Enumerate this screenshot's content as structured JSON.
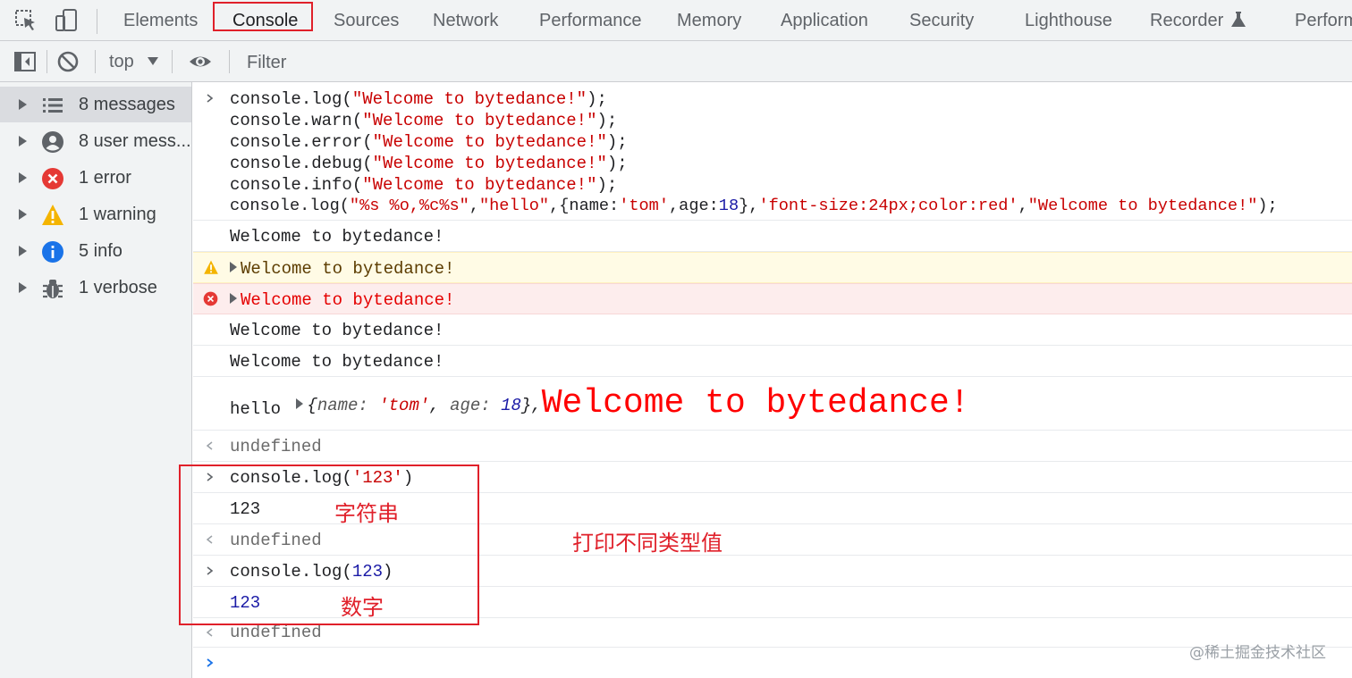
{
  "tabs": [
    {
      "label": "Elements"
    },
    {
      "label": "Console"
    },
    {
      "label": "Sources"
    },
    {
      "label": "Network"
    },
    {
      "label": "Performance"
    },
    {
      "label": "Memory"
    },
    {
      "label": "Application"
    },
    {
      "label": "Security"
    },
    {
      "label": "Lighthouse"
    },
    {
      "label": "Recorder"
    },
    {
      "label": "Perform"
    }
  ],
  "active_tab": "Console",
  "toolbar": {
    "context": "top",
    "filter_placeholder": "Filter"
  },
  "sidebar": {
    "items": [
      {
        "label": "8 messages",
        "icon": "list-icon"
      },
      {
        "label": "8 user mess...",
        "icon": "user-icon"
      },
      {
        "label": "1 error",
        "icon": "error-icon"
      },
      {
        "label": "1 warning",
        "icon": "warning-icon"
      },
      {
        "label": "5 info",
        "icon": "info-icon"
      },
      {
        "label": "1 verbose",
        "icon": "bug-icon"
      }
    ]
  },
  "console": {
    "input1": {
      "l1_a": "console.log(",
      "l1_s": "\"Welcome to bytedance!\"",
      "l1_b": ");",
      "l2_a": "console.warn(",
      "l2_s": "\"Welcome to bytedance!\"",
      "l2_b": ");",
      "l3_a": "console.error(",
      "l3_s": "\"Welcome to bytedance!\"",
      "l3_b": ");",
      "l4_a": "console.debug(",
      "l4_s": "\"Welcome to bytedance!\"",
      "l4_b": ");",
      "l5_a": "console.info(",
      "l5_s": "\"Welcome to bytedance!\"",
      "l5_b": ");",
      "l6_a": "console.log(",
      "l6_s1": "\"%s %o,%c%s\"",
      "l6_c1": ",",
      "l6_s2": "\"hello\"",
      "l6_c2": ",{name:",
      "l6_s3": "'tom'",
      "l6_c3": ",age:",
      "l6_n1": "18",
      "l6_c4": "},",
      "l6_s4": "'font-size:24px;color:red'",
      "l6_c5": ",",
      "l6_s5": "\"Welcome to bytedance!\"",
      "l6_b": ");"
    },
    "out_log": "Welcome to bytedance!",
    "out_warn": "Welcome to bytedance!",
    "out_error": "Welcome to bytedance!",
    "out_debug": "Welcome to bytedance!",
    "out_info": "Welcome to bytedance!",
    "out_fmt": {
      "hello": "hello",
      "obj_open": "{",
      "k1": "name:",
      "v1": "'tom'",
      "sep": ", ",
      "k2": "age:",
      "v2": "18",
      "obj_close": "},",
      "styled": "Welcome to bytedance!"
    },
    "undefined_label": "undefined",
    "input2": {
      "a": "console.log(",
      "s": "'123'",
      "b": ")"
    },
    "out2": "123",
    "input3": {
      "a": "console.log(",
      "n": "123",
      "b": ")"
    },
    "out3": "123"
  },
  "annotations": {
    "string_label": "字符串",
    "number_label": "数字",
    "title": "打印不同类型值"
  },
  "watermark": "@稀土掘金技术社区",
  "colors": {
    "annotation_red": "#e0202a",
    "string_red": "#c80000",
    "number_blue": "#1a1aa6",
    "warning_bg": "#fffbe5",
    "error_bg": "#fdeded"
  }
}
